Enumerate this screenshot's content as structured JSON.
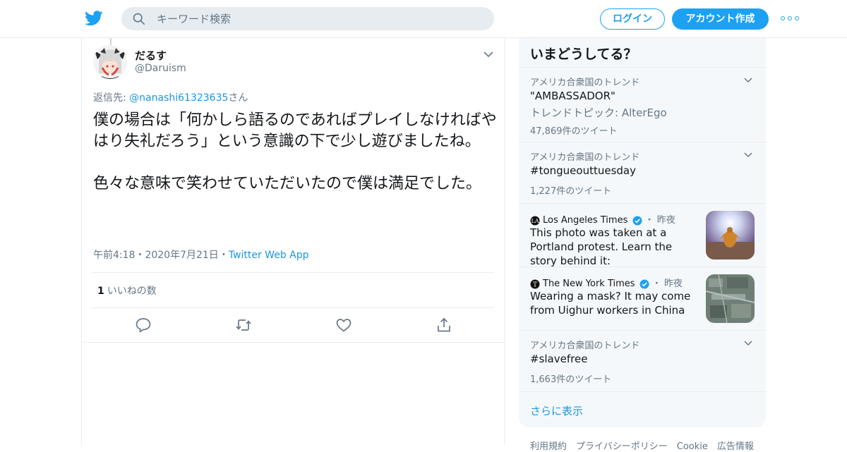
{
  "header": {
    "logo_icon": "twitter-bird-icon",
    "search": {
      "icon": "search-icon",
      "placeholder": "キーワード検索",
      "value": ""
    },
    "login_label": "ログイン",
    "signup_label": "アカウント作成",
    "more_icon": "more-dots-icon"
  },
  "tweet": {
    "avatar_icon": "user-avatar",
    "display_name": "だるす",
    "handle": "@Daruism",
    "reply_prefix": "返信先: ",
    "reply_to": "@nanashi61323635",
    "reply_suffix": "さん",
    "text_1": "僕の場合は「何かしら語るのであればプレイしなければやはり失礼だろう」という意識の下で少し遊びましたね。",
    "text_2": "色々な意味で笑わせていただいたので僕は満足でした。",
    "time": "午前4:18",
    "dot": "・",
    "date": "2020年7月21日",
    "source": "Twitter Web App",
    "like_count": "1",
    "like_label": "いいねの数",
    "actions": [
      "reply-icon",
      "retweet-icon",
      "like-icon",
      "share-icon"
    ]
  },
  "sidebar": {
    "title": "いまどうしてる？",
    "trends": [
      {
        "context": "アメリカ合衆国のトレンド",
        "name": "\"AMBASSADOR\"",
        "sub": "トレンドトピック: AlterEgo",
        "count": "47,869件のツイート"
      },
      {
        "context": "アメリカ合衆国のトレンド",
        "name": "#tongueouttuesday",
        "count": "1,227件のツイート"
      }
    ],
    "news": [
      {
        "source": "Los Angeles Times",
        "ago": "昨夜",
        "headline": "This photo was taken at a Portland protest. Learn the story behind it:"
      },
      {
        "source": "The New York Times",
        "ago": "昨夜",
        "headline": "Wearing a mask? It may come from Uighur workers in China"
      }
    ],
    "trend_last": {
      "context": "アメリカ合衆国のトレンド",
      "name": "#slavefree",
      "count": "1,663件のツイート"
    },
    "show_more": "さらに表示"
  },
  "footer": {
    "text": "利用規約　プライバシーポリシー　Cookie　広告情報"
  },
  "colors": {
    "accent": "#1da1f2",
    "link": "#1b95e0",
    "muted": "#657786",
    "border": "#e6ecf0",
    "panel": "#f5f8fa"
  }
}
